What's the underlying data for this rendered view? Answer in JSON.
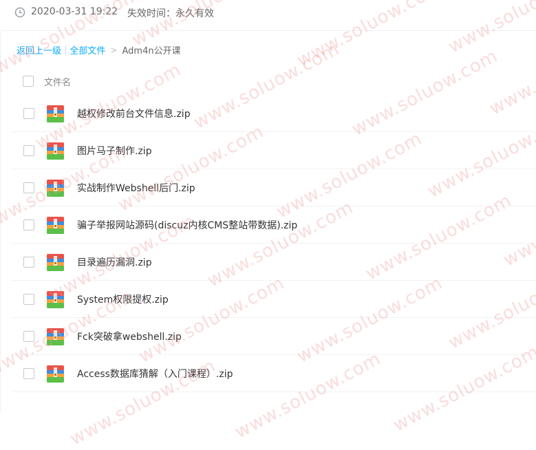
{
  "header": {
    "date": "2020-03-31 19:22",
    "expiry": "失效时间：永久有效"
  },
  "breadcrumb": {
    "back": "返回上一级",
    "separator": "|",
    "all_files": "全部文件",
    "arrow": ">",
    "current": "Adm4n公开课"
  },
  "table": {
    "column_name": "文件名"
  },
  "files": [
    {
      "name": "越权修改前台文件信息.zip"
    },
    {
      "name": "图片马子制作.zip"
    },
    {
      "name": "实战制作Webshell后门.zip"
    },
    {
      "name": "骗子举报网站源码(discuz内核CMS整站带数据).zip"
    },
    {
      "name": "目录遍历漏洞.zip"
    },
    {
      "name": "System权限提权.zip"
    },
    {
      "name": "Fck突破拿webshell.zip"
    },
    {
      "name": "Access数据库猜解（入门课程）.zip"
    }
  ],
  "watermark": {
    "text": "www.soluow.com"
  },
  "icons": {
    "clock": "clock-icon",
    "zip": "zip-file-icon"
  }
}
